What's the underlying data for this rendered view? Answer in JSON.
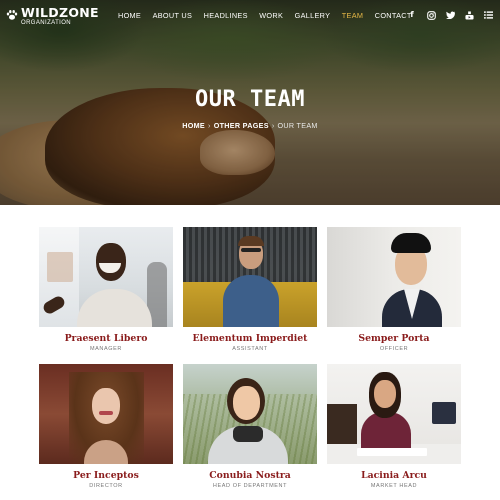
{
  "logo": {
    "name": "WILDZONE",
    "tagline": "ORGANIZATION",
    "icon": "paw-icon"
  },
  "nav": {
    "items": [
      {
        "label": "HOME",
        "active": false
      },
      {
        "label": "ABOUT US",
        "active": false
      },
      {
        "label": "HEADLINES",
        "active": false
      },
      {
        "label": "WORK",
        "active": false
      },
      {
        "label": "GALLERY",
        "active": false
      },
      {
        "label": "TEAM",
        "active": true
      },
      {
        "label": "CONTACT",
        "active": false
      }
    ],
    "social": [
      {
        "icon": "facebook-icon",
        "glyph": "f"
      },
      {
        "icon": "instagram-icon",
        "glyph": "◎"
      },
      {
        "icon": "twitter-icon",
        "glyph": "🐦"
      },
      {
        "icon": "youtube-icon",
        "glyph": "▶"
      },
      {
        "icon": "menu-icon",
        "glyph": "☰"
      }
    ],
    "active_color": "#e6b847"
  },
  "hero": {
    "title": "OUR TEAM",
    "breadcrumb": {
      "home": "HOME",
      "parent": "OTHER PAGES",
      "current": "OUR TEAM",
      "separator": "›"
    }
  },
  "team": [
    {
      "name": "Praesent Libero",
      "role": "MANAGER"
    },
    {
      "name": "Elementum Imperdiet",
      "role": "ASSISTANT"
    },
    {
      "name": "Semper Porta",
      "role": "OFFICER"
    },
    {
      "name": "Per Inceptos",
      "role": "DIRECTOR"
    },
    {
      "name": "Conubia Nostra",
      "role": "HEAD OF DEPARTMENT"
    },
    {
      "name": "Lacinia Arcu",
      "role": "MARKET HEAD"
    }
  ],
  "colors": {
    "name_color": "#8a1c1c",
    "role_color": "#777777"
  }
}
